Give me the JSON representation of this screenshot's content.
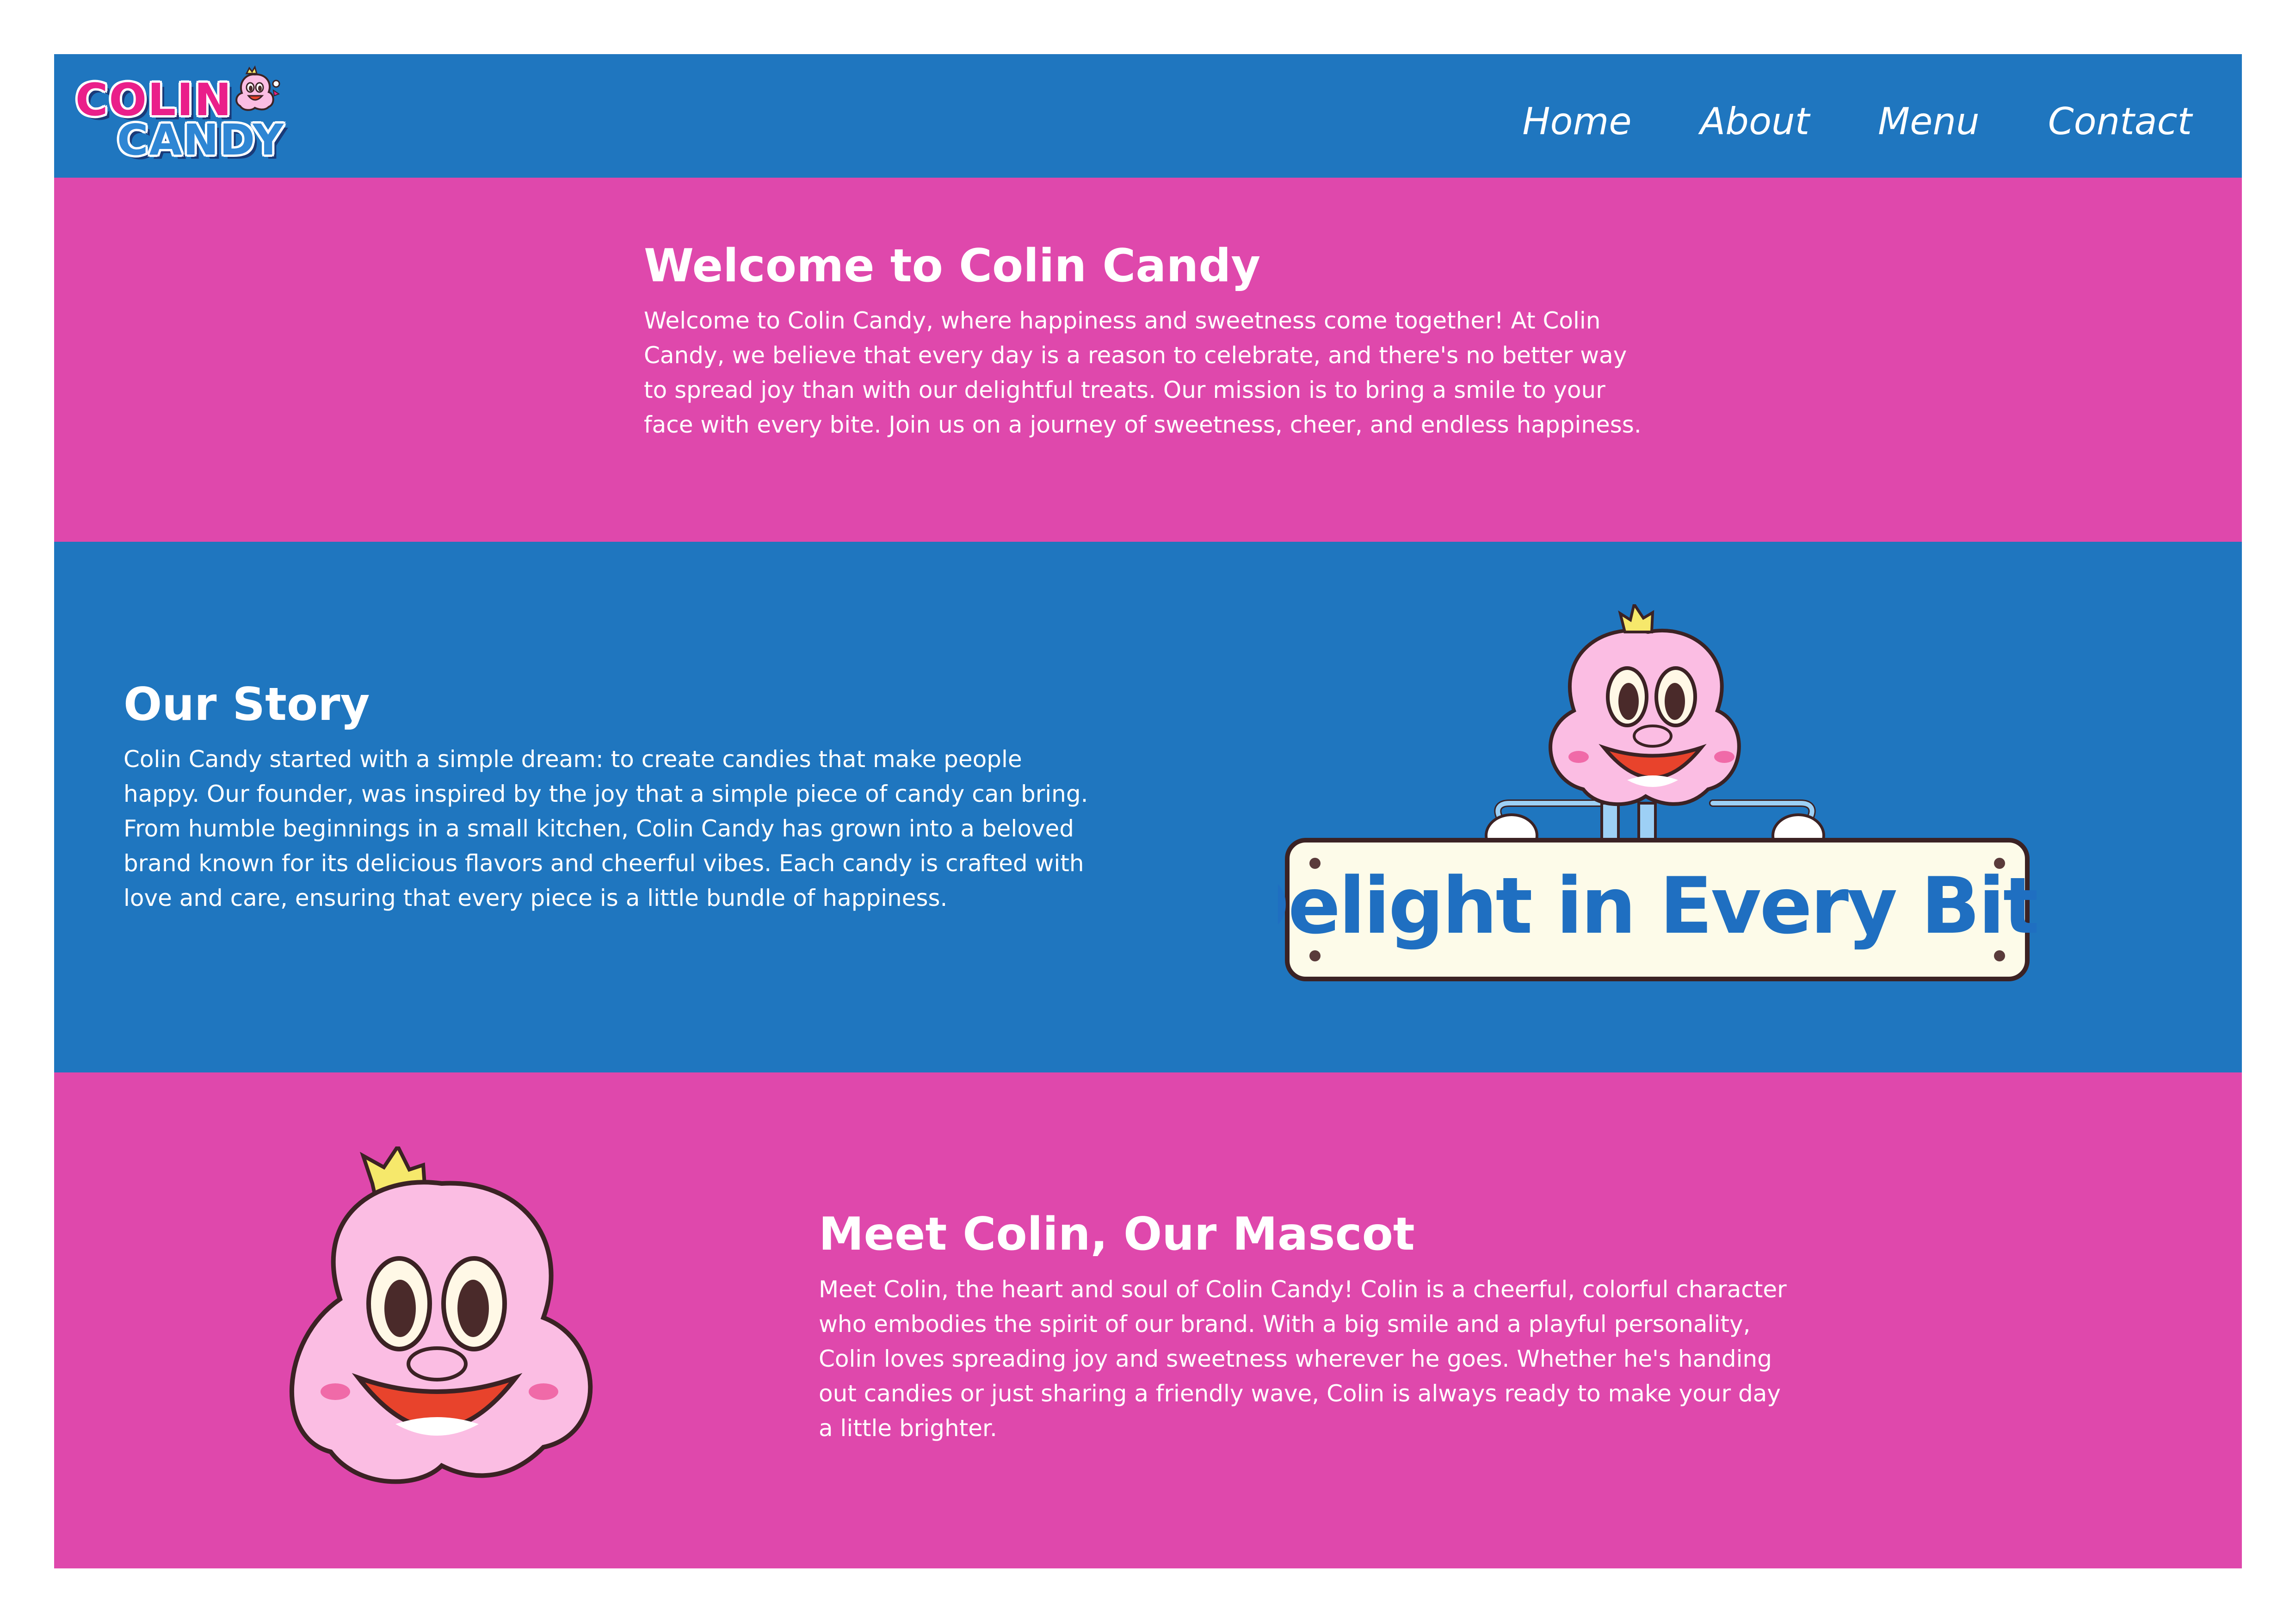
{
  "header": {
    "logo": {
      "line1": "COLIN",
      "line2": "CANDY"
    },
    "nav": [
      "Home",
      "About",
      "Menu",
      "Contact"
    ]
  },
  "welcome": {
    "title": "Welcome to Colin Candy",
    "body": "Welcome to Colin Candy, where happiness and sweetness come together! At Colin Candy, we believe that every day is a reason to celebrate, and there's no better way to spread joy than with our delightful treats. Our mission is to bring a smile to your face with every bite. Join us on a journey of sweetness, cheer, and endless happiness."
  },
  "story": {
    "title": "Our Story",
    "body": "Colin Candy started with a simple dream: to create candies that make people happy. Our founder, was inspired by the joy that a simple piece of candy can bring. From humble beginnings in a small kitchen, Colin Candy has grown into a beloved brand known for its delicious flavors and cheerful vibes. Each candy is crafted with love and care, ensuring that every piece is a little bundle of happiness.",
    "sign_text": "Delight in Every Bite"
  },
  "mascot": {
    "title": "Meet Colin, Our Mascot",
    "body": "Meet Colin, the heart and soul of Colin Candy! Colin is a cheerful, colorful character who embodies the spirit of our brand. With a big smile and a playful personality, Colin loves spreading joy and sweetness wherever he goes. Whether he's handing out candies or just sharing a friendly wave, Colin is always ready to make your day a little brighter."
  },
  "colors": {
    "blue": "#1f76bf",
    "pink": "#df48ac",
    "mascot_pink": "#fbbde3",
    "sign_bg": "#fdfbe9",
    "sign_text": "#1f6fc1"
  }
}
